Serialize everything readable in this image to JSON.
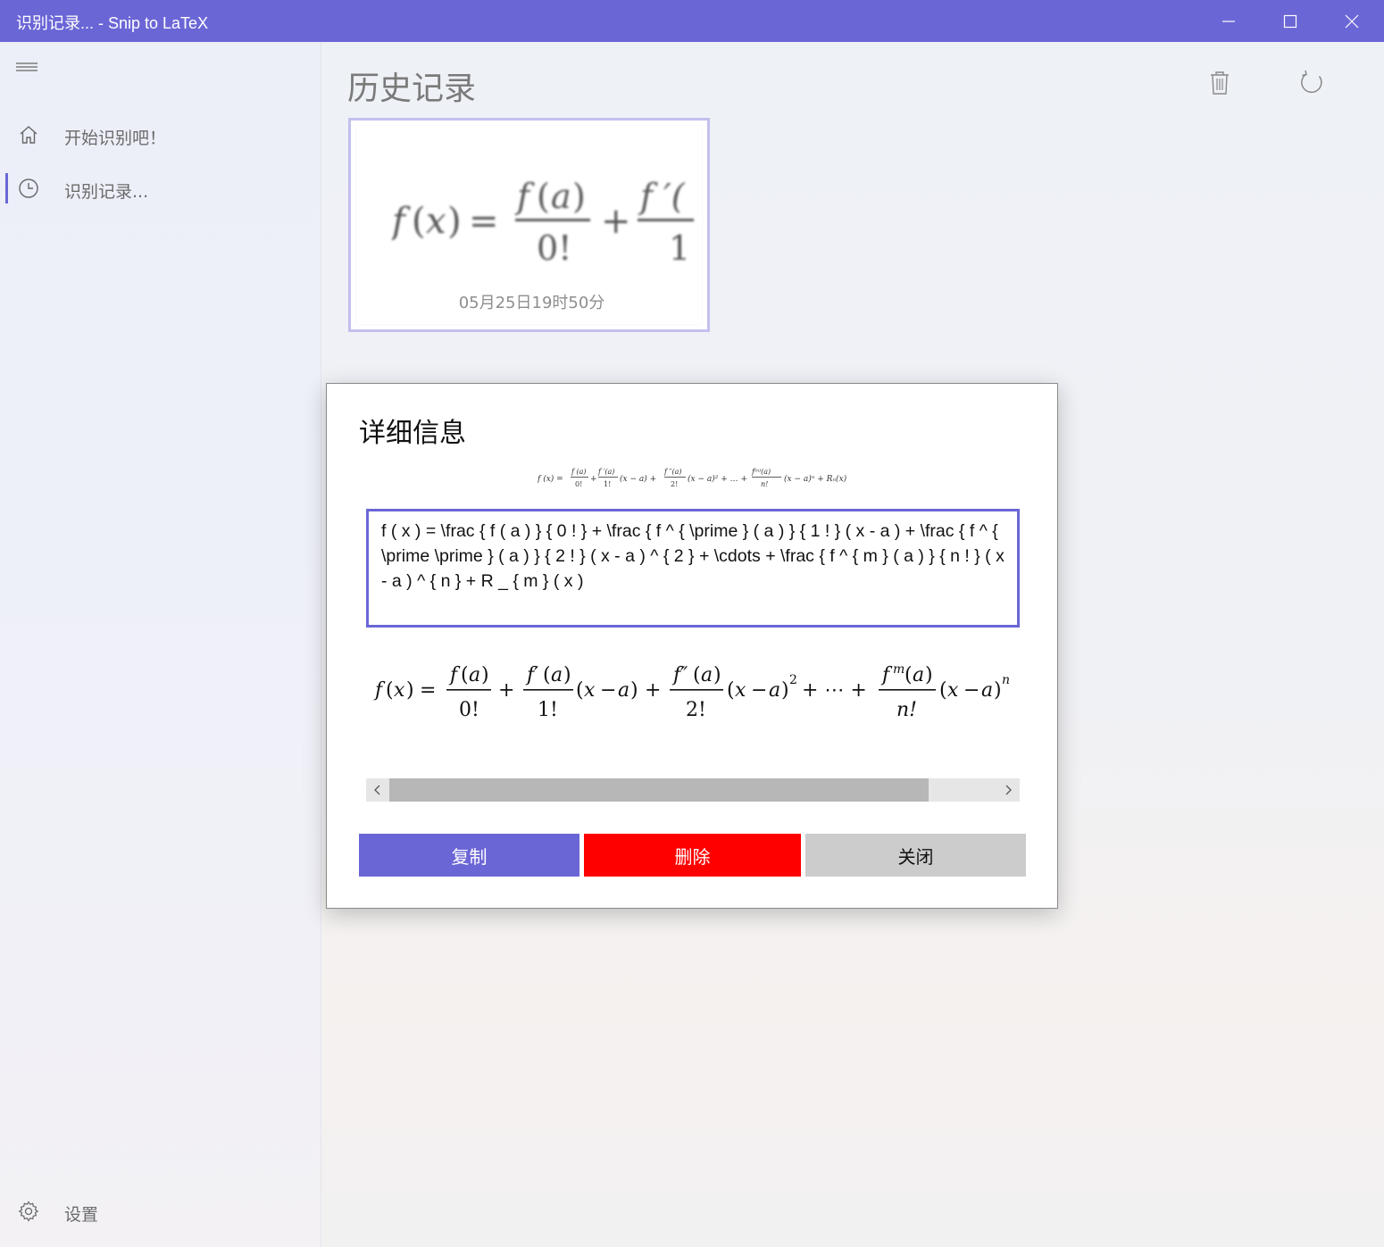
{
  "window": {
    "title": "识别记录... - Snip to LaTeX",
    "accent_color": "#6b66d6"
  },
  "sidebar": {
    "items": [
      {
        "label": "开始识别吧！",
        "icon": "home-icon"
      },
      {
        "label": "识别记录...",
        "icon": "clock-icon",
        "selected": true
      }
    ],
    "settings_label": "设置"
  },
  "main": {
    "title": "历史记录",
    "toolbar": {
      "delete_icon": "trash-icon",
      "refresh_icon": "refresh-icon"
    },
    "history": [
      {
        "date": "05月25日19时50分"
      }
    ]
  },
  "dialog": {
    "title": "详细信息",
    "latex": "f ( x ) = \\frac { f ( a ) } { 0 ! } + \\frac { f ^ { \\prime } ( a ) } { 1 ! } ( x - a ) + \\frac { f ^ { \\prime \\prime } ( a ) } { 2 ! } ( x - a ) ^ { 2 } + \\cdots + \\frac { f ^ { m } ( a ) } { n ! } ( x - a ) ^ { n } + R _ { m } ( x )",
    "buttons": {
      "copy": "复制",
      "delete": "删除",
      "close": "关闭"
    },
    "button_colors": {
      "copy": "#6b66d6",
      "delete": "#ff0000",
      "close": "#cccccc"
    },
    "scrollbar_position": 0.83
  }
}
